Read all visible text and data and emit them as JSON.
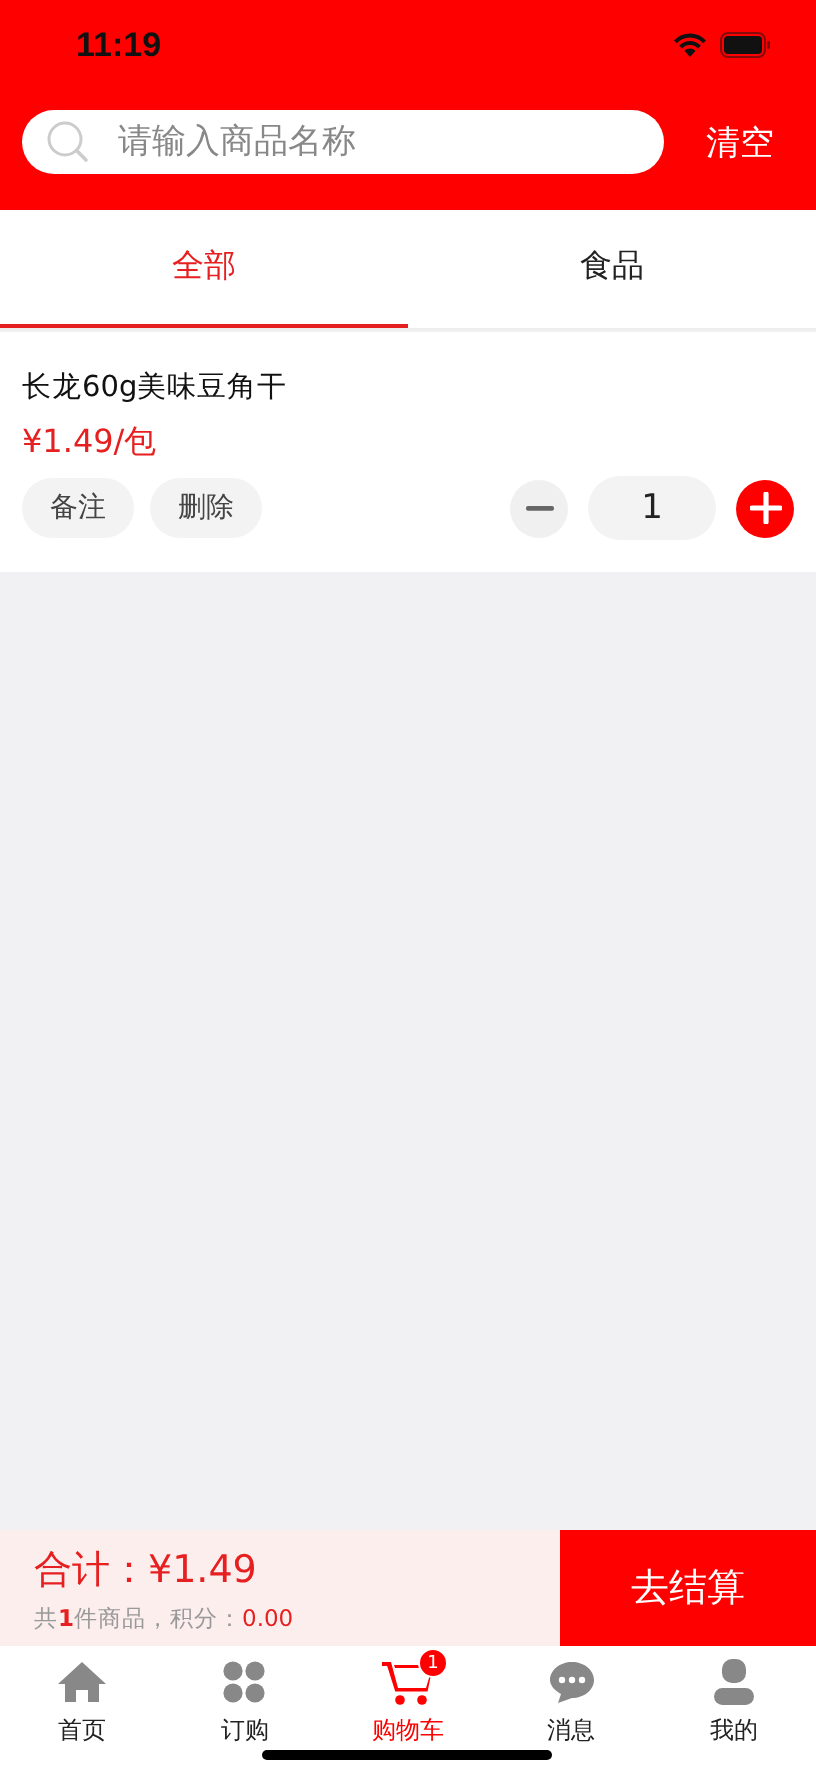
{
  "status_bar": {
    "time": "11:19"
  },
  "search": {
    "placeholder": "请输入商品名称",
    "clear_label": "清空"
  },
  "tabs": [
    {
      "label": "全部",
      "selected": true
    },
    {
      "label": "食品",
      "selected": false
    }
  ],
  "cart_items": [
    {
      "name": "长龙60g美味豆角干",
      "price": "¥1.49/包",
      "actions": [
        "备注",
        "删除"
      ],
      "quantity": "1"
    }
  ],
  "checkout": {
    "total_label": "合计：",
    "total": "¥1.49",
    "summary_parts": [
      {
        "text": "共",
        "kind": "plain"
      },
      {
        "text": "1",
        "kind": "count"
      },
      {
        "text": "件商品，积分：",
        "kind": "plain"
      },
      {
        "text": "0.00",
        "kind": "value"
      }
    ],
    "button": "去结算"
  },
  "bottom_nav": [
    {
      "label": "首页",
      "kind": "home",
      "selected": false
    },
    {
      "label": "订购",
      "kind": "grid",
      "selected": false
    },
    {
      "label": "购物车",
      "kind": "cart",
      "selected": true,
      "badge": "1"
    },
    {
      "label": "消息",
      "kind": "chat",
      "selected": false
    },
    {
      "label": "我的",
      "kind": "user",
      "selected": false
    }
  ]
}
